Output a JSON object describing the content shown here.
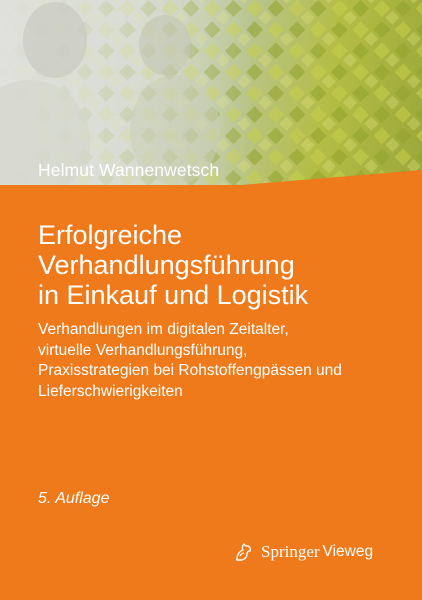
{
  "book": {
    "author": "Helmut Wannenwetsch",
    "title_lines": [
      "Erfolgreiche",
      "Verhandlungsführung",
      "in Einkauf und Logistik"
    ],
    "subtitle_lines": [
      "Verhandlungen im digitalen Zeitalter,",
      "virtuelle Verhandlungsführung,",
      "Praxisstrategien bei Rohstoffengpässen und",
      "Lieferschwierigkeiten"
    ],
    "edition": "5. Auflage"
  },
  "publisher": {
    "name_part1": "Springer",
    "name_part2": "Vieweg",
    "logo_icon": "springer-horse-icon"
  },
  "colors": {
    "background": "#ef7a1c",
    "text": "#ffffff",
    "photo_green": "#b4bd45"
  }
}
